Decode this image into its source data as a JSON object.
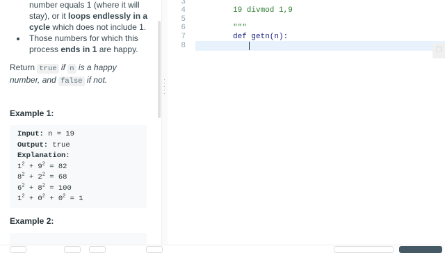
{
  "description": {
    "bullet1": {
      "pre": "number equals 1 (where it will stay), or it ",
      "bold": "loops endlessly in a cycle",
      "post": " which does not include 1."
    },
    "bullet2": {
      "pre": "Those numbers for which this process ",
      "bold": "ends in 1",
      "post": " are happy."
    },
    "return_text": {
      "w1": "Return ",
      "c1": "true",
      "w2": " if ",
      "c2": "n",
      "w3": " is a happy number, and ",
      "c3": "false",
      "w4": " if not."
    }
  },
  "example1": {
    "title": "Example 1:",
    "input_label": "Input:",
    "input_value": " n = 19",
    "output_label": "Output:",
    "output_value": " true",
    "explanation_label": "Explanation:",
    "lines": [
      [
        "1",
        "2",
        " + 9",
        "2",
        " = 82"
      ],
      [
        "8",
        "2",
        " + 2",
        "2",
        " = 68"
      ],
      [
        "6",
        "2",
        " + 8",
        "2",
        " = 100"
      ],
      [
        "1",
        "2",
        " + 0",
        "2",
        " + 0",
        "2",
        " = 1"
      ]
    ]
  },
  "example2": {
    "title": "Example 2:"
  },
  "editor": {
    "line_numbers": [
      "3",
      "4",
      "5",
      "6",
      "7",
      "8"
    ],
    "lines": [
      "\"\"\"",
      "19 divmod 1,9",
      "",
      "\"\"\"",
      "def getn(n):",
      ""
    ]
  },
  "icons": {
    "grip": "drag-handle-icon",
    "side": "copy-icon"
  },
  "colors": {
    "active_line": "#e8f2fc",
    "code_string": "#2e7d32",
    "code_keyword": "#1a237e"
  }
}
